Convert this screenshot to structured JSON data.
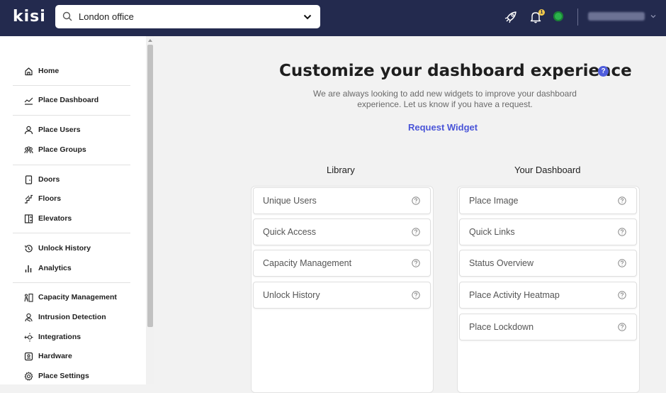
{
  "app": {
    "logo": "kisi"
  },
  "search": {
    "value": "London office"
  },
  "sidebar": {
    "groups": [
      [
        {
          "label": "Home",
          "icon": "home-icon"
        }
      ],
      [
        {
          "label": "Place Dashboard",
          "icon": "chart-line-icon"
        }
      ],
      [
        {
          "label": "Place Users",
          "icon": "user-icon"
        },
        {
          "label": "Place Groups",
          "icon": "users-icon"
        }
      ],
      [
        {
          "label": "Doors",
          "icon": "door-icon"
        },
        {
          "label": "Floors",
          "icon": "stairs-icon"
        },
        {
          "label": "Elevators",
          "icon": "elevator-icon"
        }
      ],
      [
        {
          "label": "Unlock History",
          "icon": "history-icon"
        },
        {
          "label": "Analytics",
          "icon": "bar-chart-icon"
        }
      ],
      [
        {
          "label": "Capacity Management",
          "icon": "capacity-icon"
        },
        {
          "label": "Intrusion Detection",
          "icon": "intrusion-icon"
        },
        {
          "label": "Integrations",
          "icon": "integrations-icon"
        },
        {
          "label": "Hardware",
          "icon": "hardware-icon"
        },
        {
          "label": "Place Settings",
          "icon": "gear-icon"
        }
      ]
    ]
  },
  "main": {
    "title": "Customize your dashboard experience",
    "help_symbol": "?",
    "subtitle": "We are always looking to add new widgets to improve your dashboard experience. Let us know if you have a request.",
    "request_link": "Request Widget",
    "library": {
      "heading": "Library",
      "items": [
        "Unique Users",
        "Quick Access",
        "Capacity Management",
        "Unlock History"
      ]
    },
    "dashboard": {
      "heading": "Your Dashboard",
      "items": [
        "Place Image",
        "Quick Links",
        "Status Overview",
        "Place Activity Heatmap",
        "Place Lockdown"
      ]
    }
  },
  "notifications": {
    "count": "1"
  },
  "colors": {
    "topbar": "#232a4e",
    "accent": "#4a55d8",
    "status": "#2bb24c"
  }
}
